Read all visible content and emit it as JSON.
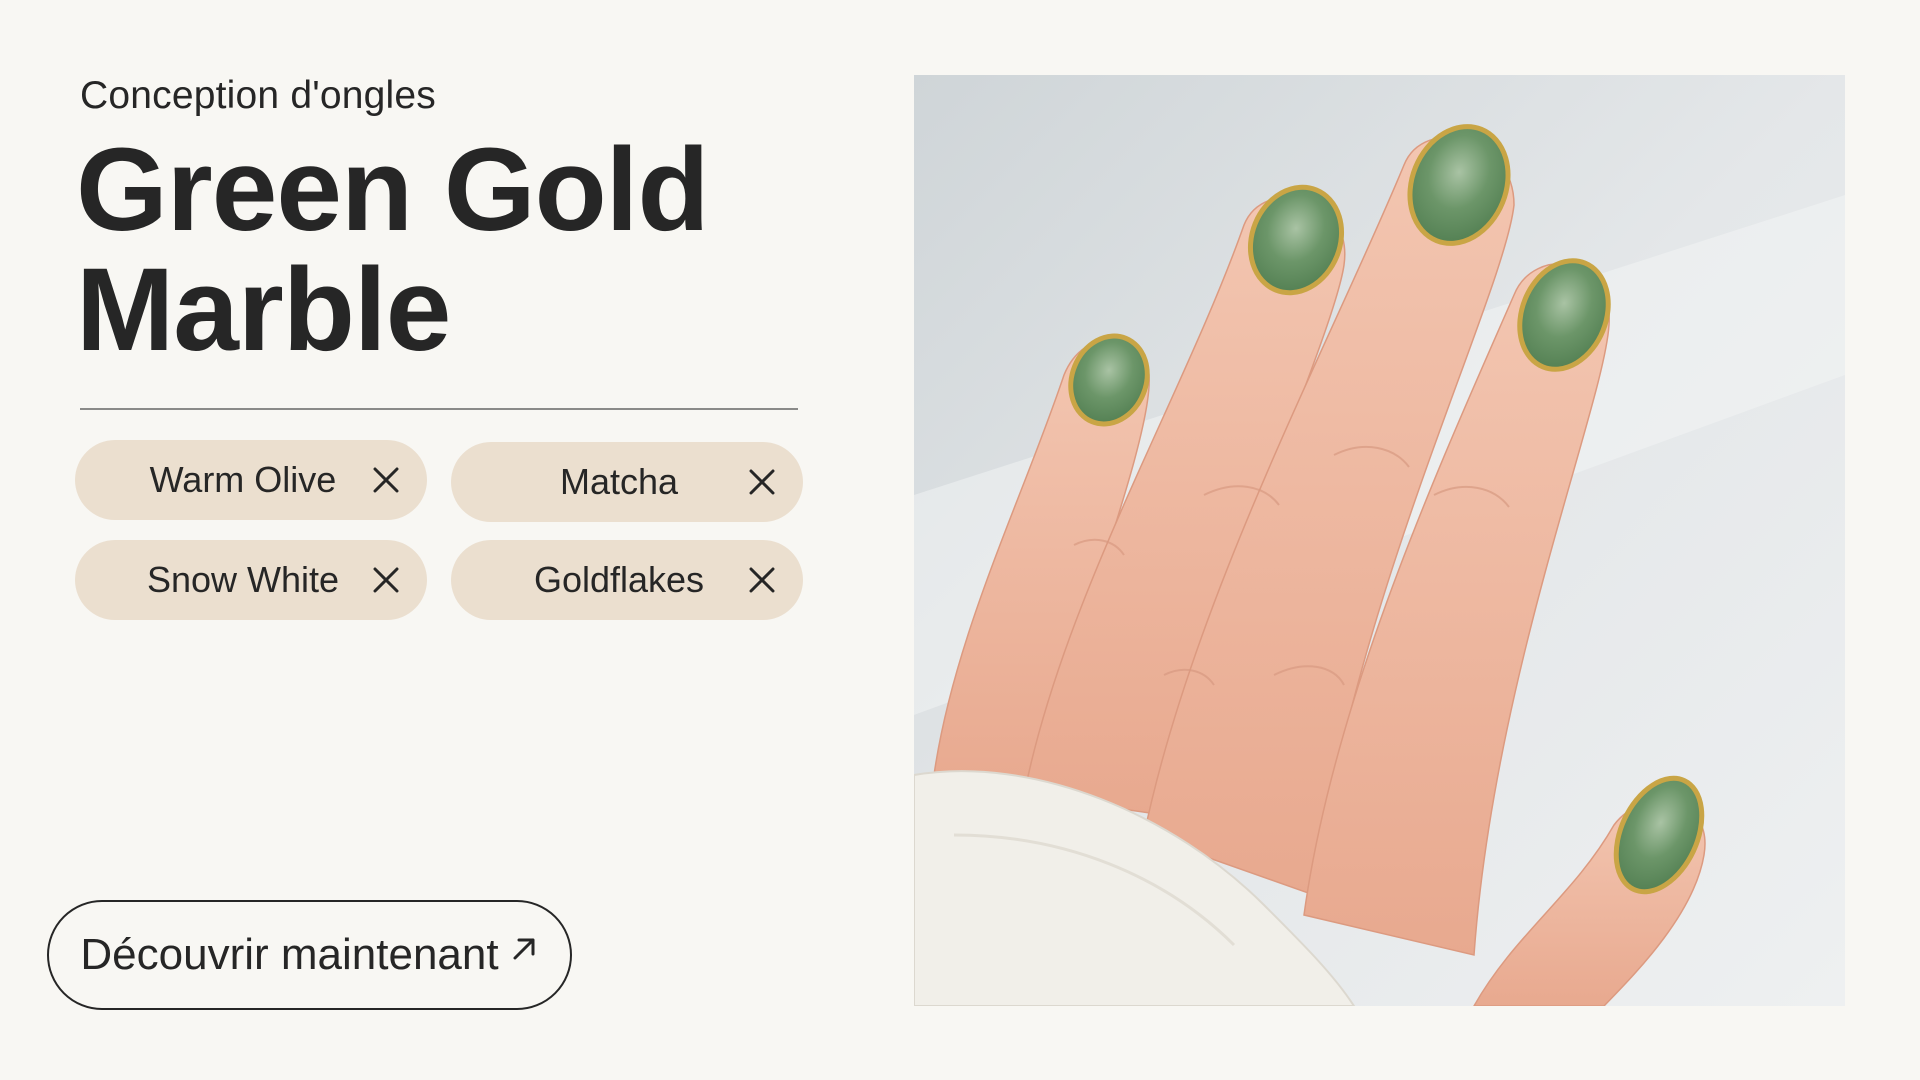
{
  "header": {
    "subtitle": "Conception d'ongles",
    "title": "Green Gold Marble"
  },
  "tags": [
    {
      "label": "Warm Olive"
    },
    {
      "label": "Matcha"
    },
    {
      "label": "Snow White"
    },
    {
      "label": "Goldflakes"
    }
  ],
  "cta": {
    "label": "Découvrir maintenant",
    "icon": "arrow-up-right-icon"
  },
  "photo": {
    "subject": "hand-with-green-gold-marble-nails"
  },
  "colors": {
    "background": "#f8f7f3",
    "chip": "#ebdfcf",
    "text": "#262626",
    "nail_green": "#5f8a5c",
    "gold": "#c9a545",
    "skin": "#efbfa8"
  }
}
